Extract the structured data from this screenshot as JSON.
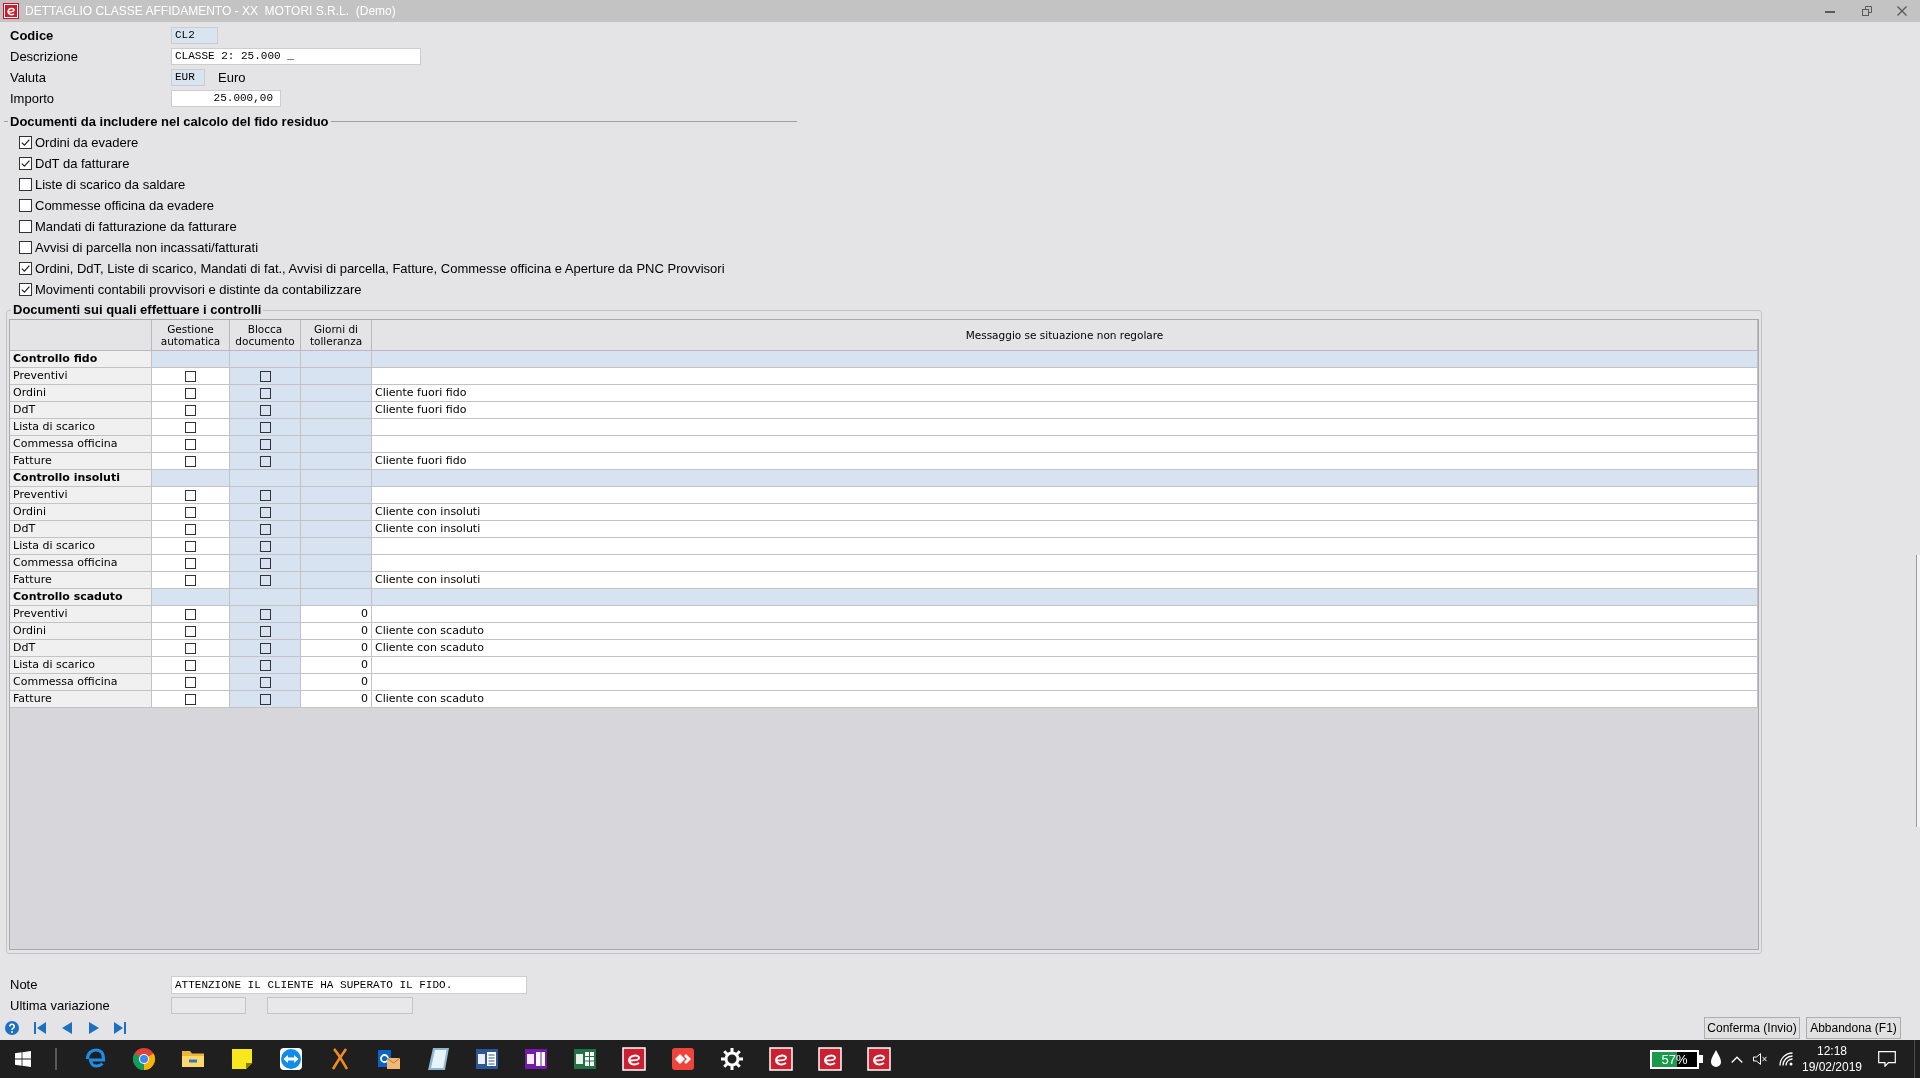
{
  "window": {
    "title": "DETTAGLIO CLASSE AFFIDAMENTO - XX  MOTORI S.R.L.  (Demo)"
  },
  "fields": [
    {
      "label": "Codice",
      "required": true,
      "kind": "code",
      "value": "CL2"
    },
    {
      "label": "Descrizione",
      "required": false,
      "kind": "text",
      "value": "CLASSE 2: 25.000 _"
    },
    {
      "label": "Valuta",
      "required": false,
      "kind": "lookup",
      "value": "EUR",
      "description": "Euro"
    },
    {
      "label": "Importo",
      "required": false,
      "kind": "amount",
      "value": "25.000,00"
    }
  ],
  "include_section": {
    "title": "Documenti da includere nel calcolo del fido residuo",
    "options": [
      {
        "label": "Ordini da evadere",
        "checked": true
      },
      {
        "label": "DdT da fatturare",
        "checked": true
      },
      {
        "label": "Liste di scarico da saldare",
        "checked": false
      },
      {
        "label": "Commesse officina da evadere",
        "checked": false
      },
      {
        "label": "Mandati di fatturazione da fatturare",
        "checked": false
      },
      {
        "label": "Avvisi di parcella non incassati/fatturati",
        "checked": false
      },
      {
        "label": "Ordini, DdT, Liste di scarico, Mandati di fat., Avvisi di parcella, Fatture, Commesse officina e Aperture da PNC Provvisori",
        "checked": true
      },
      {
        "label": "Movimenti contabili provvisori e distinte da contabilizzare",
        "checked": true
      }
    ]
  },
  "controls_section": {
    "title": "Documenti sui quali effettuare i controlli",
    "columns": [
      {
        "label": "Gestione automatica",
        "disabled": false
      },
      {
        "label": "Blocca documento",
        "disabled": true
      },
      {
        "label": "Giorni di tolleranza",
        "disabled": false
      },
      {
        "label": "Messaggio se situazione non regolare",
        "disabled": false
      }
    ],
    "groups": [
      {
        "title": "Controllo fido",
        "tolerance_enabled": false,
        "rows": [
          {
            "label": "Preventivi",
            "auto": false,
            "block": false
          },
          {
            "label": "Ordini",
            "auto": false,
            "block": false,
            "message": "Cliente fuori fido"
          },
          {
            "label": "DdT",
            "auto": false,
            "block": false,
            "message": "Cliente fuori fido"
          },
          {
            "label": "Lista di scarico",
            "auto": false,
            "block": false
          },
          {
            "label": "Commessa officina",
            "auto": false,
            "block": false
          },
          {
            "label": "Fatture",
            "auto": false,
            "block": false,
            "message": "Cliente fuori fido"
          }
        ]
      },
      {
        "title": "Controllo insoluti",
        "tolerance_enabled": false,
        "rows": [
          {
            "label": "Preventivi",
            "auto": false,
            "block": false
          },
          {
            "label": "Ordini",
            "auto": false,
            "block": false,
            "message": "Cliente con insoluti"
          },
          {
            "label": "DdT",
            "auto": false,
            "block": false,
            "message": "Cliente con insoluti"
          },
          {
            "label": "Lista di scarico",
            "auto": false,
            "block": false
          },
          {
            "label": "Commessa officina",
            "auto": false,
            "block": false
          },
          {
            "label": "Fatture",
            "auto": false,
            "block": false,
            "message": "Cliente con insoluti"
          }
        ]
      },
      {
        "title": "Controllo scaduto",
        "tolerance_enabled": true,
        "rows": [
          {
            "label": "Preventivi",
            "auto": false,
            "block": false,
            "days": "0"
          },
          {
            "label": "Ordini",
            "auto": false,
            "block": false,
            "days": "0",
            "message": "Cliente con scaduto"
          },
          {
            "label": "DdT",
            "auto": false,
            "block": false,
            "days": "0",
            "message": "Cliente con scaduto"
          },
          {
            "label": "Lista di scarico",
            "auto": false,
            "block": false,
            "days": "0"
          },
          {
            "label": "Commessa officina",
            "auto": false,
            "block": false,
            "days": "0"
          },
          {
            "label": "Fatture",
            "auto": false,
            "block": false,
            "days": "0",
            "message": "Cliente con scaduto"
          }
        ]
      }
    ]
  },
  "note": {
    "label": "Note",
    "value": "ATTENZIONE IL CLIENTE HA SUPERATO IL FIDO."
  },
  "last_change": {
    "label": "Ultima variazione",
    "fields": [
      {
        "disabled": true
      },
      {
        "disabled": true
      }
    ]
  },
  "buttons": [
    {
      "label": "Conferma (Invio)"
    },
    {
      "label": "Abbandona (F1)"
    }
  ],
  "taskbar": {
    "battery": "57%",
    "time": "12:18",
    "date": "19/02/2019"
  }
}
